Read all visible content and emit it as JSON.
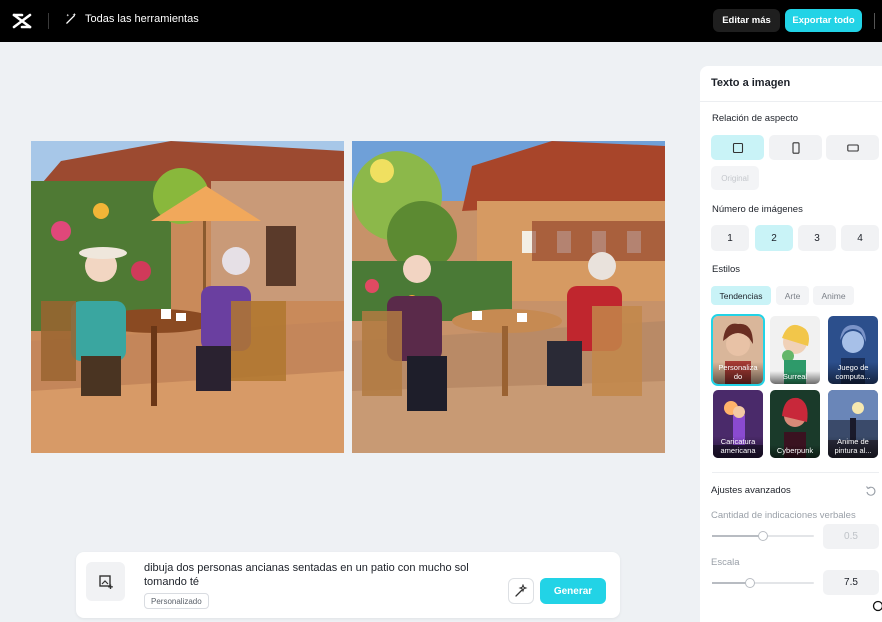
{
  "topbar": {
    "logo_icon": "capcut-logo-icon",
    "tools_label": "Todas las herramientas",
    "edit_more_label": "Editar más",
    "export_label": "Exportar todo",
    "accent": "#22d3e6"
  },
  "prompt": {
    "text": "dibuja dos personas ancianas sentadas en un patio con mucho sol tomando té",
    "tag": "Personalizado",
    "generate_label": "Generar"
  },
  "panel": {
    "title": "Texto a imagen",
    "aspect_label": "Relación de aspecto",
    "aspect_options": [
      "square",
      "portrait",
      "landscape"
    ],
    "aspect_selected": "square",
    "original_label": "Original",
    "count_label": "Número de imágenes",
    "counts": [
      "1",
      "2",
      "3",
      "4"
    ],
    "count_selected": "2",
    "styles_label": "Estilos",
    "style_tabs": [
      "Tendencias",
      "Arte",
      "Anime"
    ],
    "style_tab_selected": "Tendencias",
    "styles": [
      {
        "name": "Personalizado",
        "caption": "Personaliza do"
      },
      {
        "name": "Surreal",
        "caption": "Surreal"
      },
      {
        "name": "Juego de computadora",
        "caption": "Juego de computa..."
      },
      {
        "name": "Caricatura americana",
        "caption": "Caricatura americana"
      },
      {
        "name": "Cyberpunk",
        "caption": "Cyberpunk"
      },
      {
        "name": "Anime de pintura al óleo",
        "caption": "Anime de pintura al..."
      }
    ],
    "advanced_label": "Ajustes avanzados",
    "verbal_label": "Cantidad de indicaciones verbales",
    "verbal_value": "0.5",
    "scale_label": "Escala",
    "scale_value": "7.5"
  }
}
